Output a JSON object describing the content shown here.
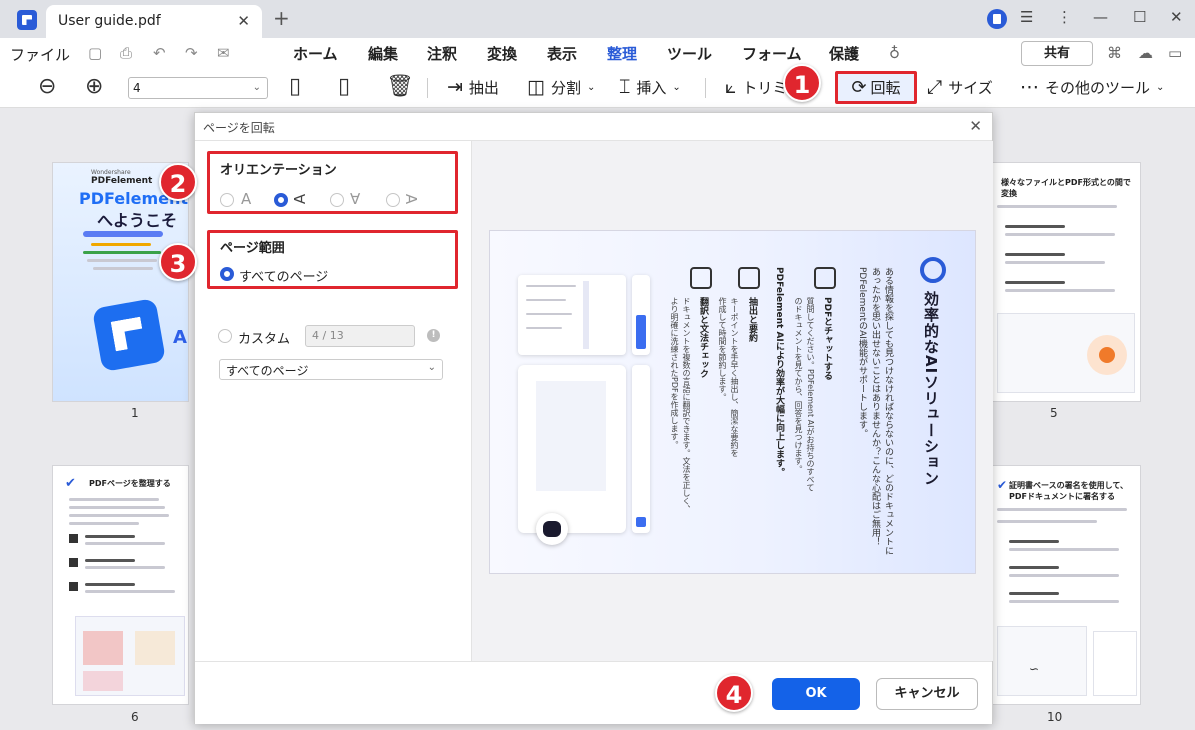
{
  "titlebar": {
    "tab_title": "User guide.pdf",
    "tab_close": "✕",
    "new_tab": "+",
    "minimize": "—",
    "maximize": "☐",
    "close": "✕",
    "more": "⋮"
  },
  "menubar": {
    "file": "ファイル",
    "items": [
      "ホーム",
      "編集",
      "注釈",
      "変換",
      "表示",
      "整理",
      "ツール",
      "フォーム",
      "保護"
    ],
    "active": "整理",
    "share": "共有"
  },
  "toolbar": {
    "page_value": "4",
    "extract": "抽出",
    "split": "分割",
    "insert": "挿入",
    "trim": "トリミ",
    "rotate": "回転",
    "size": "サイズ",
    "more_tools": "その他のツール"
  },
  "thumbnails": {
    "p1_num": "1",
    "p5_num": "5",
    "p6_num": "6",
    "p10_num": "10",
    "p1_brand_small": "Wondershare",
    "p1_brand": "PDFelement",
    "p1_title": "PDFelement",
    "p1_title2": "へようこそ",
    "p5_title": "様々なファイルとPDF形式との間で変換",
    "p6_title": "PDFページを整理する",
    "p10_title": "証明書ベースの署名を使用して、PDFドキュメントに署名する"
  },
  "dialog": {
    "title": "ページを回転",
    "close": "✕",
    "orientation_title": "オリエンテーション",
    "orientation_glyphs": [
      "A",
      "∀",
      "∀",
      "∀"
    ],
    "orientation_selected_index": 1,
    "range_title": "ページ範囲",
    "all_pages": "すべてのページ",
    "custom": "カスタム",
    "custom_value": "4 / 13",
    "info": "!",
    "range_dropdown": "すべてのページ",
    "ok": "OK",
    "cancel": "キャンセル",
    "preview": {
      "heading": "効率的なAIソリューション",
      "intro": "ある情報を探しても見つけなければならないのに、どのドキュメントにあったかを思い出せないことはありませんか？こんな心配はご無用！PDFelementのAI機能がサポートします。",
      "feature1_title": "PDFとチャットする",
      "feature1_text": "質問してください。PDFelement AIがお持ちのすべてのドキュメントを見てから、回答を見つけます。",
      "feature2_title": "PDFelement AIにより効率が大幅に向上します。",
      "feature3_title": "抽出と要約",
      "feature3_text": "キーポイントを手早く抽出し、簡潔な要約を作成して時間を節約します。",
      "feature4_title": "翻訳と文法チェック",
      "feature4_text": "ドキュメントを複数の言語に翻訳できます。文法を正しく、より明確に洗練されたPDFを作成します。"
    }
  },
  "badges": [
    "1",
    "2",
    "3",
    "4"
  ],
  "colors": {
    "accent": "#2a5bd7",
    "highlight_red": "#e0262e",
    "ok_button": "#1462e8"
  }
}
